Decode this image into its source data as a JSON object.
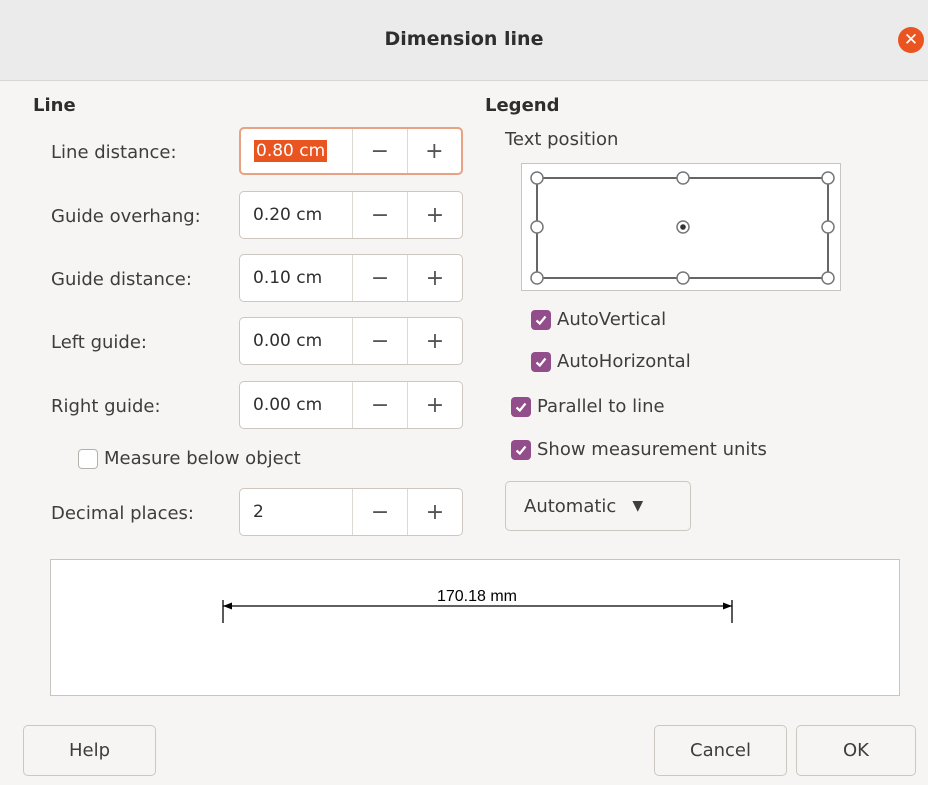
{
  "dialog": {
    "title": "Dimension line"
  },
  "line": {
    "heading": "Line",
    "fields": [
      {
        "label": "Line distance:",
        "value": "0.80 cm"
      },
      {
        "label": "Guide overhang:",
        "value": "0.20 cm"
      },
      {
        "label": "Guide distance:",
        "value": "0.10 cm"
      },
      {
        "label": "Left guide:",
        "value": "0.00 cm"
      },
      {
        "label": "Right guide:",
        "value": "0.00 cm"
      }
    ],
    "measure_below": {
      "label": "Measure below object",
      "checked": false
    },
    "decimal_places": {
      "label": "Decimal places:",
      "value": "2"
    },
    "minus_glyph": "−",
    "plus_glyph": "+"
  },
  "legend": {
    "heading": "Legend",
    "text_position_label": "Text position",
    "auto_vertical": {
      "label": "AutoVertical",
      "checked": true
    },
    "auto_horizontal": {
      "label": "AutoHorizontal",
      "checked": true
    },
    "parallel": {
      "label": "Parallel to line",
      "checked": true
    },
    "show_units": {
      "label": "Show measurement units",
      "checked": true
    },
    "units_dropdown": {
      "value": "Automatic"
    }
  },
  "preview": {
    "measurement": "170.18 mm"
  },
  "buttons": {
    "help": "Help",
    "cancel": "Cancel",
    "ok": "OK"
  },
  "colors": {
    "accent": "#e95420",
    "check": "#924d8b"
  }
}
